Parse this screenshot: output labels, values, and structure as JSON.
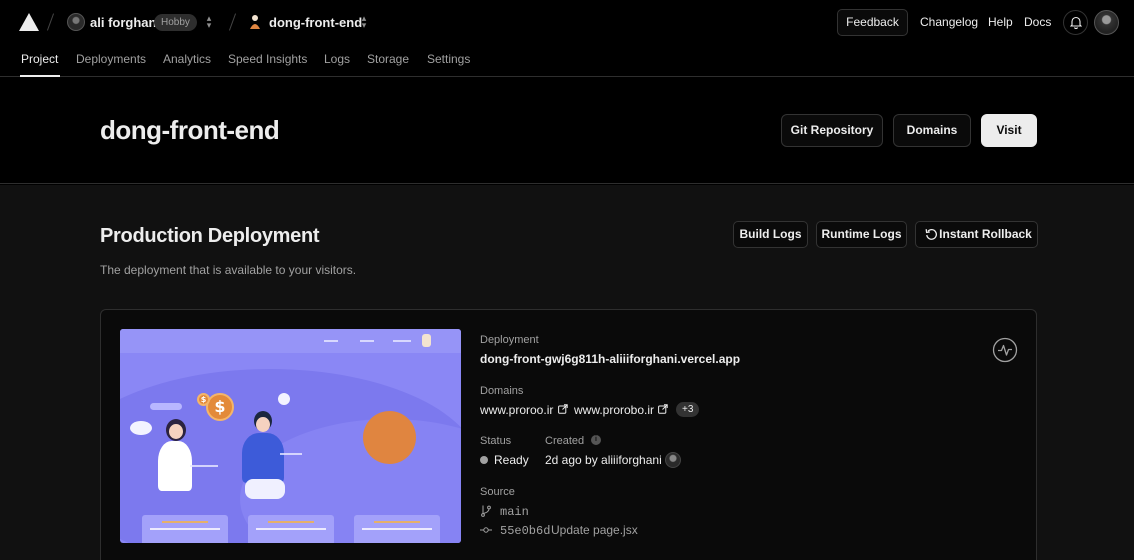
{
  "topbar": {
    "user_name": "ali forghani",
    "plan_badge": "Hobby",
    "project_name": "dong-front-end",
    "feedback_label": "Feedback",
    "links": {
      "changelog": "Changelog",
      "help": "Help",
      "docs": "Docs"
    }
  },
  "tabs": [
    "Project",
    "Deployments",
    "Analytics",
    "Speed Insights",
    "Logs",
    "Storage",
    "Settings"
  ],
  "active_tab": "Project",
  "header": {
    "title": "dong-front-end",
    "git_repository_label": "Git Repository",
    "domains_label": "Domains",
    "visit_label": "Visit"
  },
  "production": {
    "title": "Production Deployment",
    "subtitle": "The deployment that is available to your visitors.",
    "build_logs_label": "Build Logs",
    "runtime_logs_label": "Runtime Logs",
    "rollback_label": "Instant Rollback"
  },
  "deployment": {
    "deployment_label": "Deployment",
    "deployment_url": "dong-front-gwj6g811h-aliiiforghani.vercel.app",
    "domains_label": "Domains",
    "domains": [
      "www.proroo.ir",
      "www.prorobo.ir"
    ],
    "more_domains": "+3",
    "status_label": "Status",
    "status_value": "Ready",
    "created_label": "Created",
    "created_value": "2d ago by aliiiforghani",
    "source_label": "Source",
    "branch": "main",
    "commit_hash": "55e0b6d",
    "commit_message": "Update page.jsx"
  },
  "colors": {
    "background": "#000000",
    "surface": "#111111",
    "text": "#ededed",
    "muted": "#a1a1a1",
    "border": "#2e2e2e",
    "preview_purple": "#8a87f5",
    "preview_orange": "#e08540"
  },
  "icons": [
    "vercel-triangle-icon",
    "chevron-updown-icon",
    "bell-icon",
    "external-link-icon",
    "rollback-icon",
    "git-branch-icon",
    "git-commit-icon",
    "info-icon",
    "pulse-icon"
  ]
}
